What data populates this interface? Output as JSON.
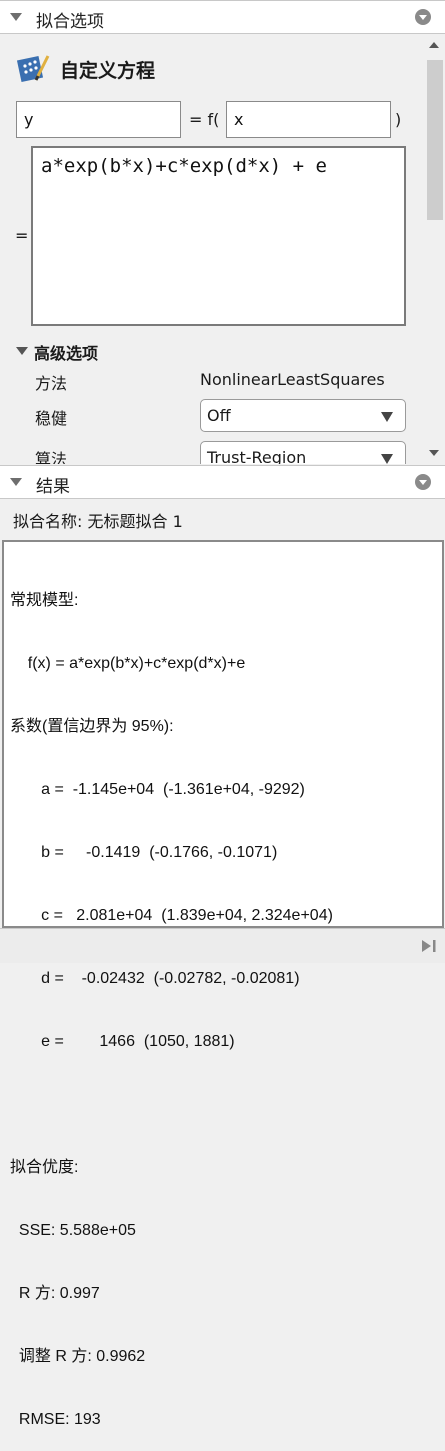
{
  "fit_options": {
    "header_title": "拟合选项",
    "equation_type": "自定义方程",
    "dependent_var": "y",
    "equals_f_label": "= f(",
    "independent_var": "x",
    "close_paren": ")",
    "equals_label": "=",
    "expression": "a*exp(b*x)+c*exp(d*x) + e",
    "advanced": {
      "title": "高级选项",
      "method_label": "方法",
      "method_value": "NonlinearLeastSquares",
      "robust_label": "稳健",
      "robust_value": "Off",
      "algorithm_label": "算法",
      "algorithm_value": "Trust-Region"
    }
  },
  "results": {
    "header_title": "结果",
    "fit_name": "拟合名称: 无标题拟合 1",
    "lines": [
      "常规模型:",
      "    f(x) = a*exp(b*x)+c*exp(d*x)+e",
      "系数(置信边界为 95%):",
      "       a =  -1.145e+04  (-1.361e+04, -9292)",
      "       b =     -0.1419  (-0.1766, -0.1071)",
      "       c =   2.081e+04  (1.839e+04, 2.324e+04)",
      "       d =    -0.02432  (-0.02782, -0.02081)",
      "       e =        1466  (1050, 1881)",
      "",
      "拟合优度:",
      "  SSE: 5.588e+05",
      "  R 方: 0.997",
      "  调整 R 方: 0.9962",
      "  RMSE: 193"
    ]
  },
  "icons": {
    "collapse": "triangle-down-icon",
    "panel_menu": "panel-menu-icon",
    "equation": "custom-equation-icon",
    "status": "skip-to-end-icon"
  }
}
